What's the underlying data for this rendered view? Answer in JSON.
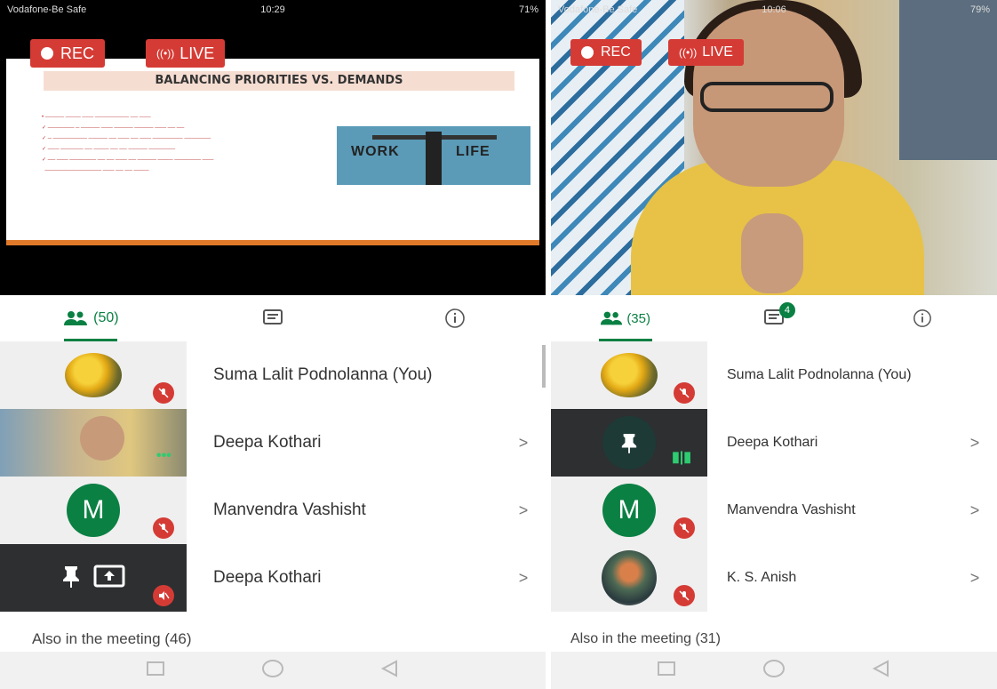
{
  "left": {
    "status": {
      "carrier": "Vodafone-Be Safe",
      "time": "10:29",
      "battery": "71%"
    },
    "rec_label": "REC",
    "live_label": "LIVE",
    "slide": {
      "title": "BALANCING PRIORITIES VS. DEMANDS",
      "work_text": "WORK",
      "life_text": "LIFE"
    },
    "tabs": {
      "people_count": "(50)"
    },
    "participants": [
      {
        "name": "Suma Lalit Podnolanna (You)"
      },
      {
        "name": "Deepa Kothari"
      },
      {
        "name": "Manvendra Vashisht",
        "initial": "M"
      },
      {
        "name": "Deepa Kothari"
      }
    ],
    "also_label": "Also in the meeting (46)"
  },
  "right": {
    "status": {
      "carrier": "Vodafone-Be Safe",
      "time": "10:06",
      "battery": "79%"
    },
    "rec_label": "REC",
    "live_label": "LIVE",
    "tabs": {
      "people_count": "(35)",
      "chat_badge": "4"
    },
    "participants": [
      {
        "name": "Suma Lalit Podnolanna (You)"
      },
      {
        "name": "Deepa Kothari"
      },
      {
        "name": "Manvendra Vashisht",
        "initial": "M"
      },
      {
        "name": "K. S. Anish"
      }
    ],
    "also_label": "Also in the meeting (31)"
  },
  "colors": {
    "accent_green": "#0a8043",
    "rec_red": "#d53b35"
  }
}
